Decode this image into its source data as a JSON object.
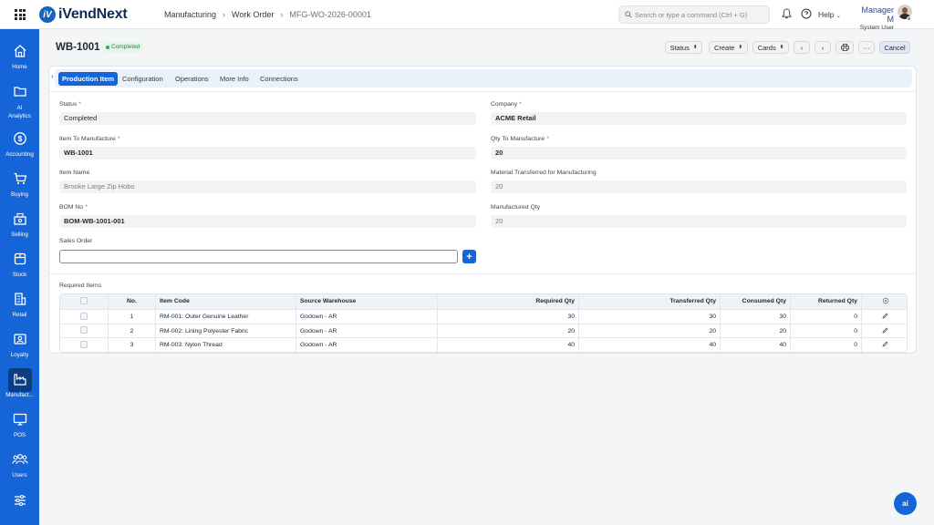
{
  "app": {
    "name": "iVendNext",
    "logo_letter": "iV"
  },
  "breadcrumb": {
    "items": [
      "Manufacturing",
      "Work Order"
    ],
    "current": "MFG-WO-2026-00001"
  },
  "search": {
    "placeholder": "Search or type a command (Ctrl + G)"
  },
  "header_right": {
    "help_label": "Help",
    "user_name": "Manager M",
    "user_role": "System User"
  },
  "sidebar": {
    "items": [
      {
        "label": "Home",
        "icon": "home-icon"
      },
      {
        "label": "AI Analytics",
        "icon": "folder-icon"
      },
      {
        "label": "Accounting",
        "icon": "dollar-icon"
      },
      {
        "label": "Buying",
        "icon": "cart-icon"
      },
      {
        "label": "Selling",
        "icon": "register-icon"
      },
      {
        "label": "Stock",
        "icon": "box-icon"
      },
      {
        "label": "Retail",
        "icon": "store-icon"
      },
      {
        "label": "Loyalty",
        "icon": "card-icon"
      },
      {
        "label": "Manufact...",
        "icon": "factory-icon",
        "active": true
      },
      {
        "label": "POS",
        "icon": "monitor-icon"
      },
      {
        "label": "Users",
        "icon": "users-icon"
      },
      {
        "label": "",
        "icon": "settings-sliders-icon"
      }
    ]
  },
  "page": {
    "title": "WB-1001",
    "status": "Completed",
    "buttons": {
      "status": "Status",
      "create": "Create",
      "cards": "Cards",
      "more": "···",
      "cancel": "Cancel"
    }
  },
  "tabs": [
    "Production Item",
    "Configuration",
    "Operations",
    "More Info",
    "Connections"
  ],
  "form": {
    "status_label": "Status",
    "status_value": "Completed",
    "company_label": "Company",
    "company_value": "ACME Retail",
    "item_label": "Item To Manufacture",
    "item_value": "WB-1001",
    "qty_label": "Qty To Manufacture",
    "qty_value": "20",
    "item_name_label": "Item Name",
    "item_name_value": "Brooke Large Zip Hobo",
    "mat_label": "Material Transferred for Manufacturing",
    "mat_value": "20",
    "bom_label": "BOM No",
    "bom_value": "BOM-WB-1001-001",
    "manuf_label": "Manufactured Qty",
    "manuf_value": "20",
    "sales_order_label": "Sales Order",
    "sales_order_value": "",
    "required_items_label": "Required Items"
  },
  "table": {
    "headers": {
      "no": "No.",
      "item_code": "Item Code",
      "warehouse": "Source Warehouse",
      "required": "Required Qty",
      "transferred": "Transferred Qty",
      "consumed": "Consumed Qty",
      "returned": "Returned Qty"
    },
    "rows": [
      {
        "no": "1",
        "item_code": "RM-001: Outer Genuine Leather",
        "warehouse": "Godown - AR",
        "required": "30",
        "transferred": "30",
        "consumed": "30",
        "returned": "0"
      },
      {
        "no": "2",
        "item_code": "RM-002: Lining Polyester Fabric",
        "warehouse": "Godown - AR",
        "required": "20",
        "transferred": "20",
        "consumed": "20",
        "returned": "0"
      },
      {
        "no": "3",
        "item_code": "RM-003: Nylon Thread",
        "warehouse": "Godown - AR",
        "required": "40",
        "transferred": "40",
        "consumed": "40",
        "returned": "0"
      }
    ]
  },
  "fab": {
    "label": "ai"
  },
  "colors": {
    "brand": "#1565d8",
    "sidebar": "#1565d8",
    "status_green": "#2e7d4f"
  }
}
